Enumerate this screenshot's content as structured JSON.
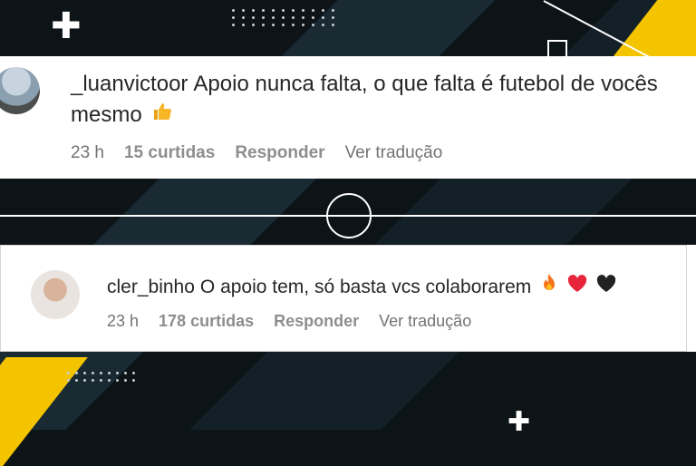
{
  "comments": [
    {
      "username": "_luanvictoor",
      "text_line1": "Apoio nunca falta, o que falta é futebol de vocês",
      "text_line2": "mesmo",
      "emojis": [
        "thumbs-up"
      ],
      "time": "23 h",
      "likes": "15 curtidas",
      "reply": "Responder",
      "translate": "Ver tradução"
    },
    {
      "username": "cler_binho",
      "text": "O apoio tem, só basta vcs colaborarem",
      "emojis": [
        "fire",
        "red-heart",
        "black-heart"
      ],
      "time": "23 h",
      "likes": "178 curtidas",
      "reply": "Responder",
      "translate": "Ver tradução"
    }
  ],
  "colors": {
    "background": "#0d1418",
    "accent_yellow": "#f5c400",
    "card": "#ffffff",
    "meta_text": "#737373"
  }
}
